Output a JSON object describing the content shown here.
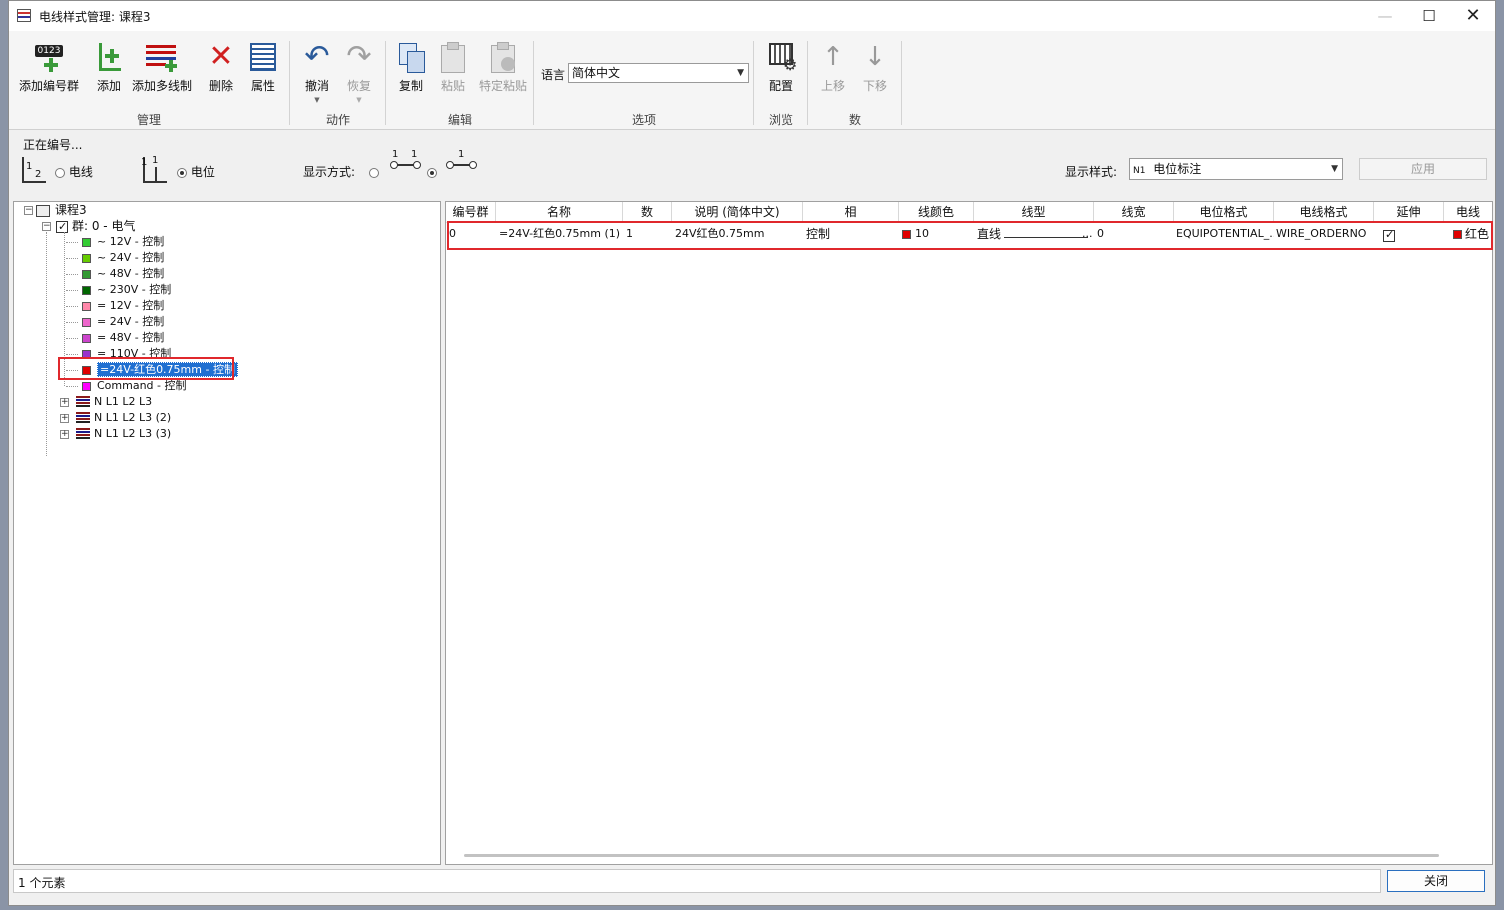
{
  "window": {
    "title": "电线样式管理: 课程3"
  },
  "ribbon": {
    "manage": {
      "add_group": "添加编号群",
      "add": "添加",
      "add_multi": "添加多线制",
      "delete": "删除",
      "properties": "属性",
      "group": "管理"
    },
    "action": {
      "undo": "撤消",
      "redo": "恢复",
      "group": "动作"
    },
    "edit": {
      "copy": "复制",
      "paste": "粘贴",
      "paste_special": "特定粘贴",
      "group": "编辑"
    },
    "options": {
      "language_label": "语言",
      "language_value": "简体中文",
      "group": "选项"
    },
    "browse": {
      "config": "配置",
      "group": "浏览"
    },
    "count": {
      "move_up": "上移",
      "move_down": "下移",
      "group": "数"
    },
    "add_group_badge": "0123"
  },
  "numbering": {
    "label": "正在编号...",
    "opt_wire": "电线",
    "opt_potential": "电位",
    "display_mode_label": "显示方式:",
    "display_style_label": "显示样式:",
    "display_style_value": "电位标注",
    "apply_button": "应用",
    "icon_digits": {
      "one": "1",
      "two": "2"
    }
  },
  "tree": {
    "root": "课程3",
    "group": "群: 0 - 电气",
    "items": [
      {
        "label": "~  12V - 控制",
        "color": "#33cc33"
      },
      {
        "label": "~  24V - 控制",
        "color": "#66cc00"
      },
      {
        "label": "~  48V - 控制",
        "color": "#339933"
      },
      {
        "label": "~ 230V - 控制",
        "color": "#006600"
      },
      {
        "label": "=  12V - 控制",
        "color": "#ff88aa"
      },
      {
        "label": "=  24V - 控制",
        "color": "#ee66cc"
      },
      {
        "label": "=  48V - 控制",
        "color": "#cc44cc"
      },
      {
        "label": "= 110V - 控制",
        "color": "#9933cc"
      },
      {
        "label": "=24V-红色0.75mm - 控制",
        "color": "#e00000"
      },
      {
        "label": "Command - 控制",
        "color": "#ff00ff"
      }
    ],
    "multi": [
      "N L1 L2 L3",
      "N L1 L2 L3 (2)",
      "N L1 L2 L3 (3)"
    ]
  },
  "table": {
    "headers": [
      "编号群",
      "名称",
      "数",
      "说明 (简体中文)",
      "相",
      "线颜色",
      "线型",
      "线宽",
      "电位格式",
      "电线格式",
      "延伸",
      "电线"
    ],
    "row": {
      "group": "0",
      "name": "=24V-红色0.75mm (1)",
      "count": "1",
      "desc": "24V红色0.75mm",
      "phase": "控制",
      "color_num": "10",
      "line_type": "直线",
      "width": "0",
      "pot_format": "EQUIPOTENTIAL_...",
      "wire_format": "WIRE_ORDERNO",
      "wire_color": "红色"
    }
  },
  "status": {
    "count": "1 个元素",
    "close": "关闭"
  }
}
